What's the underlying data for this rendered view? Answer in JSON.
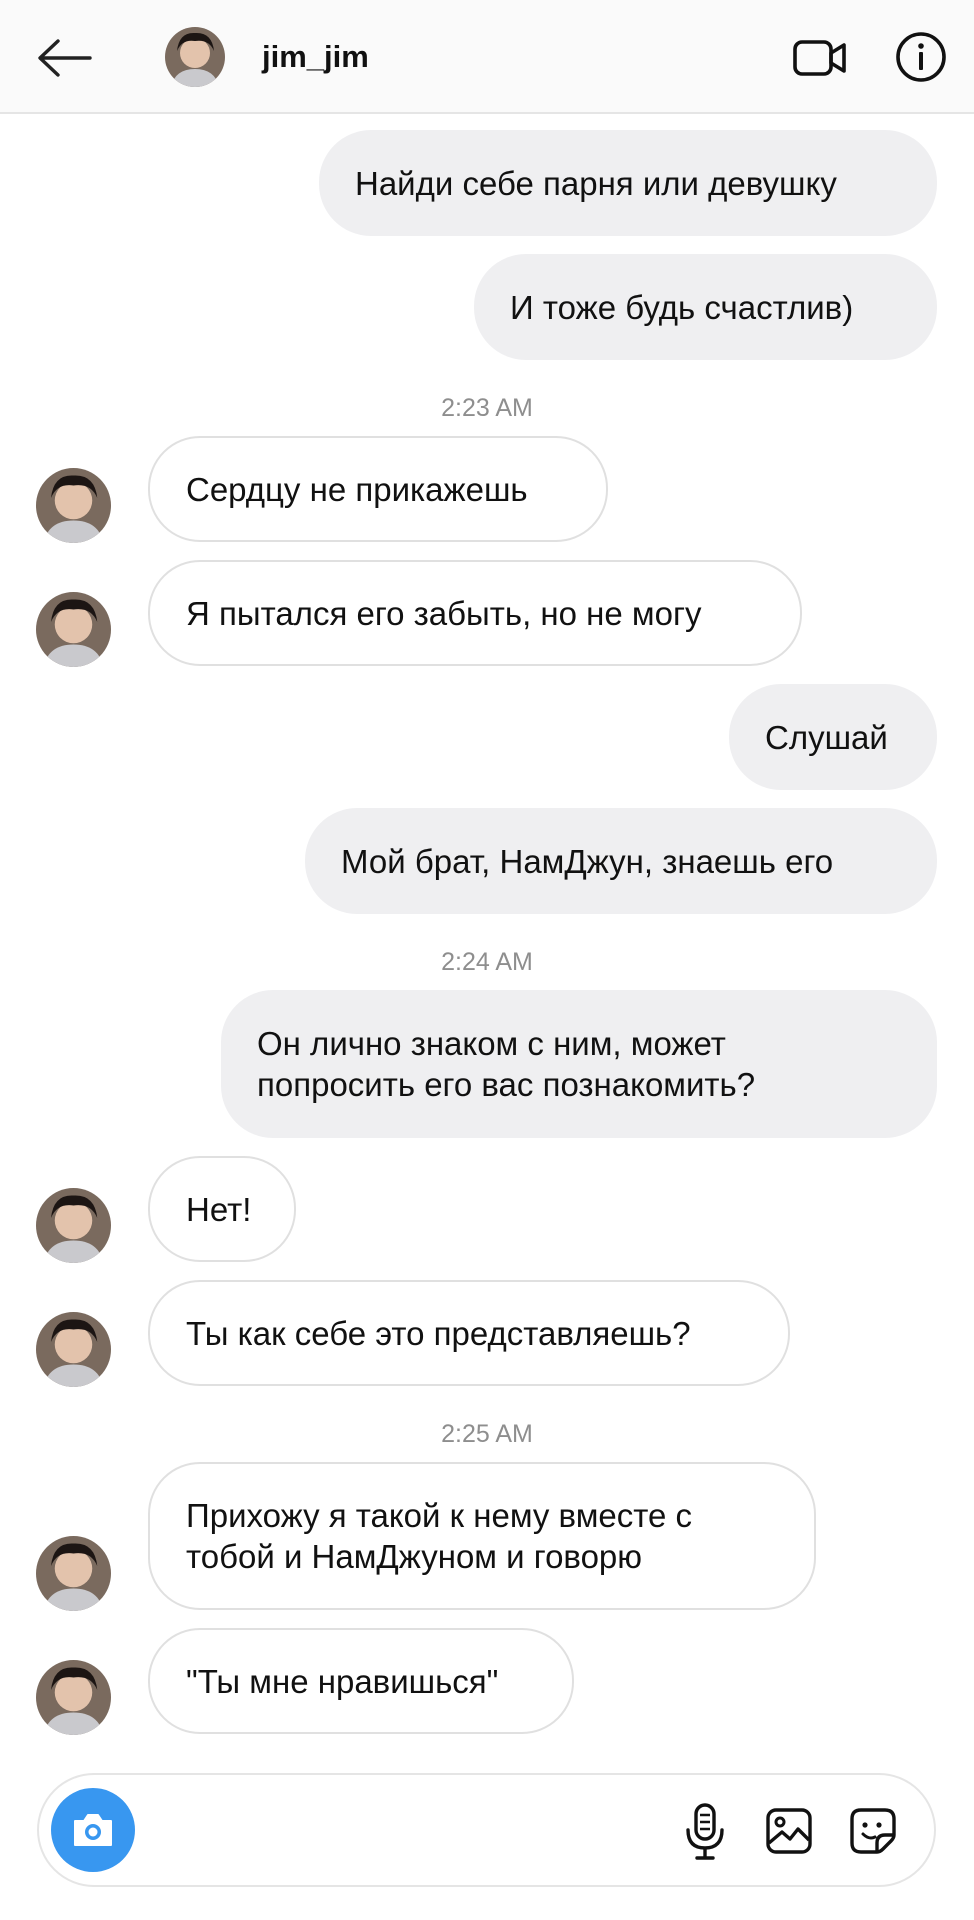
{
  "header": {
    "username": "jim_jim",
    "icons": {
      "back": "arrow-left-icon",
      "video": "video-camera-icon",
      "info": "info-icon"
    }
  },
  "messages": [
    {
      "type": "sent",
      "text": "Найди себе парня или девушку"
    },
    {
      "type": "sent",
      "text": "И тоже будь счастлив)"
    },
    {
      "type": "timestamp",
      "text": "2:23 AM"
    },
    {
      "type": "received",
      "text": "Сердцу не прикажешь"
    },
    {
      "type": "received",
      "text": "Я пытался его забыть, но не могу"
    },
    {
      "type": "sent",
      "text": "Слушай"
    },
    {
      "type": "sent",
      "text": "Мой брат, НамДжун, знаешь его"
    },
    {
      "type": "timestamp",
      "text": "2:24 AM"
    },
    {
      "type": "sent",
      "text": "Он лично знаком с ним, может попросить его вас познакомить?"
    },
    {
      "type": "received",
      "text": "Нет!"
    },
    {
      "type": "received",
      "text": "Ты как себе это представляешь?"
    },
    {
      "type": "timestamp",
      "text": "2:25 AM"
    },
    {
      "type": "received",
      "text": "Прихожу я такой к нему вместе с тобой и НамДжуном и говорю"
    },
    {
      "type": "received",
      "text": "\"Ты мне нравишься\""
    }
  ],
  "composer": {
    "value": "",
    "placeholder": "",
    "icons": {
      "camera": "camera-icon",
      "mic": "microphone-icon",
      "gallery": "gallery-icon",
      "sticker": "sticker-icon"
    },
    "accent_color": "#3897f0"
  },
  "colors": {
    "sent_bubble": "#efeff1",
    "received_border": "#e0e0e0",
    "timestamp": "#8e8e8e"
  }
}
